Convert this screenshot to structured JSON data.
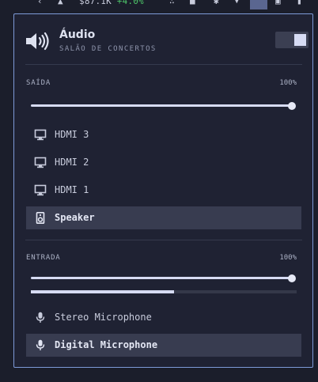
{
  "topbar": {
    "price": "$87.1K",
    "price_change": "+4.0%"
  },
  "header": {
    "title": "Áudio",
    "subtitle": "SALÃO DE CONCERTOS",
    "toggle_on": true
  },
  "output": {
    "label": "SAÍDA",
    "volume_text": "100%",
    "volume": 100,
    "devices": [
      {
        "name": "HDMI 3",
        "icon": "monitor-icon",
        "selected": false
      },
      {
        "name": "HDMI 2",
        "icon": "monitor-icon",
        "selected": false
      },
      {
        "name": "HDMI 1",
        "icon": "monitor-icon",
        "selected": false
      },
      {
        "name": "Speaker",
        "icon": "speaker-icon",
        "selected": true
      }
    ]
  },
  "input": {
    "label": "ENTRADA",
    "volume_text": "100%",
    "volume": 100,
    "level": 0.54,
    "devices": [
      {
        "name": "Stereo Microphone",
        "icon": "microphone-icon",
        "selected": false
      },
      {
        "name": "Digital Microphone",
        "icon": "microphone-icon",
        "selected": true
      }
    ]
  },
  "colors": {
    "accent": "#d6dbf3",
    "panel_border": "#7d9ad8",
    "selected_bg": "#383c50",
    "positive": "#4ec86a"
  }
}
